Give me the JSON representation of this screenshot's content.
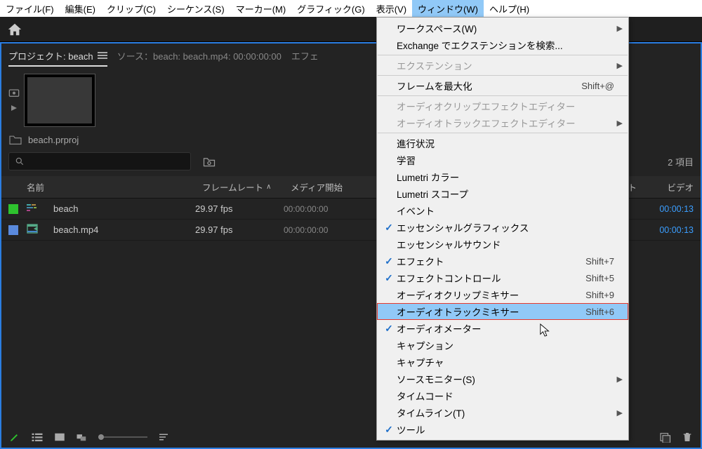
{
  "menubar": {
    "items": [
      {
        "label": "ファイル(F)"
      },
      {
        "label": "編集(E)"
      },
      {
        "label": "クリップ(C)"
      },
      {
        "label": "シーケンス(S)"
      },
      {
        "label": "マーカー(M)"
      },
      {
        "label": "グラフィック(G)"
      },
      {
        "label": "表示(V)"
      },
      {
        "label": "ウィンドウ(W)",
        "active": true
      },
      {
        "label": "ヘルプ(H)"
      }
    ]
  },
  "panel": {
    "active_tab": "プロジェクト: beach",
    "source_tab": "ソース：beach: beach.mp4: 00:00:00:00",
    "effects_tab": "エフェ",
    "video_hdr_frag": "ント",
    "video_out_hdr_frag": "ビデオ"
  },
  "project": {
    "filename": "beach.prproj",
    "item_count": "2 項目",
    "search_placeholder": ""
  },
  "table": {
    "headers": {
      "name": "名前",
      "fps": "フレームレート",
      "media_start": "メディア開始"
    },
    "rows": [
      {
        "swatch": "green",
        "icon": "seq",
        "name": "beach",
        "fps": "29.97 fps",
        "media_start": "00:00:00:00",
        "video_out": "00:00:13"
      },
      {
        "swatch": "blue",
        "icon": "clip",
        "name": "beach.mp4",
        "fps": "29.97 fps",
        "media_start": "00:00:00:00",
        "video_out": "00:00:13"
      }
    ]
  },
  "dropdown": {
    "items": [
      {
        "label": "ワークスペース(W)",
        "arrow": true
      },
      {
        "label": "Exchange でエクステンションを検索..."
      },
      {
        "sep": true
      },
      {
        "label": "エクステンション",
        "arrow": true,
        "disabled": true
      },
      {
        "sep": true
      },
      {
        "label": "フレームを最大化",
        "shortcut": "Shift+@"
      },
      {
        "sep": true
      },
      {
        "label": "オーディオクリップエフェクトエディター",
        "disabled": true
      },
      {
        "label": "オーディオトラックエフェクトエディター",
        "arrow": true,
        "disabled": true
      },
      {
        "sep": true
      },
      {
        "label": "進行状況"
      },
      {
        "label": "学習"
      },
      {
        "label": "Lumetri カラー"
      },
      {
        "label": "Lumetri スコープ"
      },
      {
        "label": "イベント"
      },
      {
        "label": "エッセンシャルグラフィックス",
        "checked": true
      },
      {
        "label": "エッセンシャルサウンド"
      },
      {
        "label": "エフェクト",
        "shortcut": "Shift+7",
        "checked": true
      },
      {
        "label": "エフェクトコントロール",
        "shortcut": "Shift+5",
        "checked": true
      },
      {
        "label": "オーディオクリップミキサー",
        "shortcut": "Shift+9"
      },
      {
        "label": "オーディオトラックミキサー",
        "shortcut": "Shift+6",
        "highlighted": true
      },
      {
        "label": "オーディオメーター",
        "checked": true
      },
      {
        "label": "キャプション"
      },
      {
        "label": "キャプチャ"
      },
      {
        "label": "ソースモニター(S)",
        "arrow": true
      },
      {
        "label": "タイムコード"
      },
      {
        "label": "タイムライン(T)",
        "arrow": true
      },
      {
        "label": "ツール",
        "checked": true
      }
    ]
  }
}
